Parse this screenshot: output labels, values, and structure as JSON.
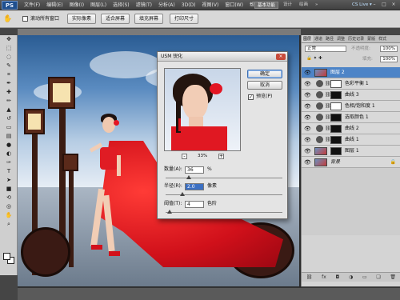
{
  "app": {
    "logo": "PS"
  },
  "menu": [
    "文件(F)",
    "编辑(E)",
    "图像(I)",
    "图层(L)",
    "选择(S)",
    "滤镜(T)",
    "分析(A)",
    "3D(D)",
    "视图(V)",
    "窗口(W)",
    "帮助(H)"
  ],
  "workspaces": {
    "active": "基本功能",
    "items": [
      "设计",
      "绘画"
    ],
    "more": "»"
  },
  "cs_live": "CS Live ▾",
  "window_controls": {
    "min": "–",
    "max": "□",
    "close": "×"
  },
  "options": {
    "scroll_all_label": "滚动所有窗口",
    "buttons": [
      "实际像素",
      "适合屏幕",
      "填充屏幕",
      "打印尺寸"
    ]
  },
  "panel": {
    "tabs": [
      "图层",
      "通道",
      "路径",
      "调整",
      "历史记录",
      "蒙版",
      "样式"
    ],
    "blend_mode": "正常",
    "opacity_label": "不透明度:",
    "opacity_value": "100%",
    "fill_label": "填充:",
    "fill_value": "100%",
    "layers": [
      {
        "name": "图层 2",
        "kind": "pixel",
        "selected": true
      },
      {
        "name": "色彩平衡 1",
        "kind": "adjust",
        "mask": "white"
      },
      {
        "name": "曲线 3",
        "kind": "adjust",
        "mask": "dark"
      },
      {
        "name": "色相/饱和度 1",
        "kind": "adjust",
        "mask": "white"
      },
      {
        "name": "选取颜色 1",
        "kind": "adjust",
        "mask": "dark"
      },
      {
        "name": "曲线 2",
        "kind": "adjust",
        "mask": "dark"
      },
      {
        "name": "曲线 1",
        "kind": "adjust",
        "mask": "dark"
      },
      {
        "name": "图层 1",
        "kind": "pixel"
      },
      {
        "name": "背景",
        "kind": "pixel",
        "locked": true
      }
    ]
  },
  "dialog": {
    "title": "USM 锐化",
    "close": "×",
    "ok": "确定",
    "cancel": "取消",
    "preview_label": "预览(P)",
    "preview_checked": "✓",
    "zoom": "33%",
    "zoom_minus": "-",
    "zoom_plus": "+",
    "amount_label": "数量(A):",
    "amount_value": "36",
    "amount_unit": "%",
    "radius_label": "半径(R):",
    "radius_value": "2.0",
    "radius_unit": "像素",
    "threshold_label": "阈值(T):",
    "threshold_value": "4",
    "threshold_unit": "色阶"
  }
}
